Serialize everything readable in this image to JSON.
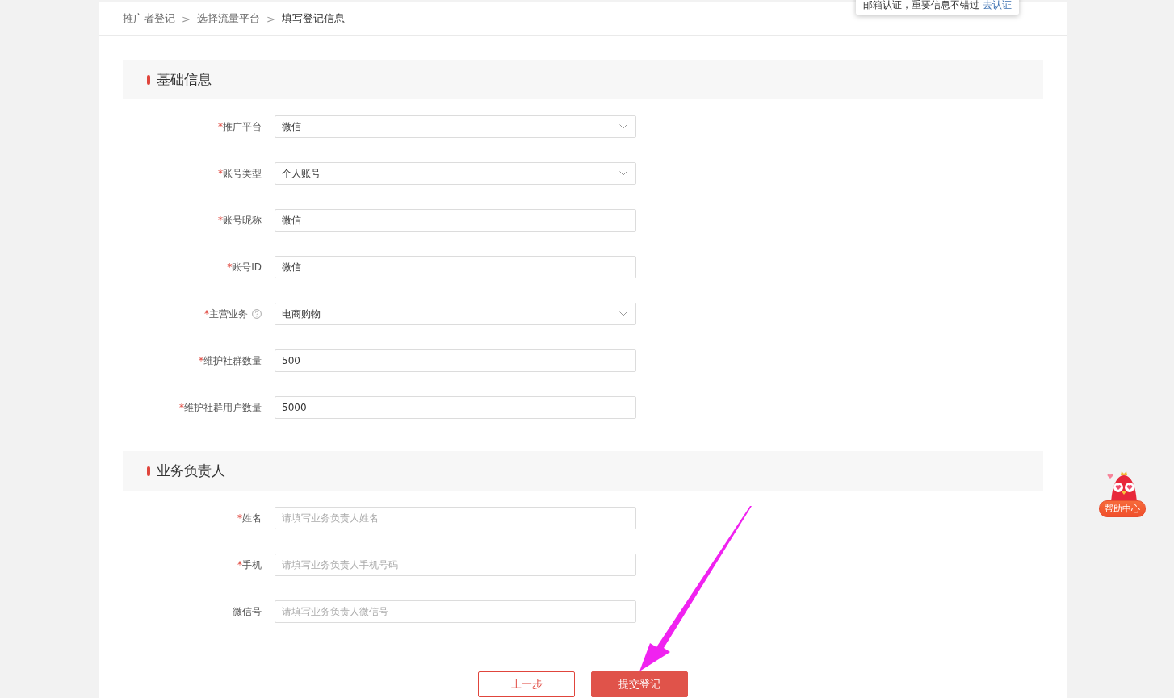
{
  "breadcrumb": [
    {
      "label": "推广者登记",
      "current": false
    },
    {
      "label": "选择流量平台",
      "current": false
    },
    {
      "label": "填写登记信息",
      "current": true
    }
  ],
  "breadcrumb_separator": ">",
  "notice": {
    "text": "邮箱认证，重要信息不错过",
    "link": "去认证"
  },
  "sections": [
    {
      "title": "基础信息",
      "fields": [
        {
          "label": "推广平台",
          "mark": "*",
          "kind": "select",
          "value": "微信"
        },
        {
          "label": "账号类型",
          "mark": "*",
          "kind": "select",
          "value": "个人账号"
        },
        {
          "label": "账号昵称",
          "mark": "*",
          "kind": "input",
          "value": "微信"
        },
        {
          "label": "账号ID",
          "mark": "*",
          "kind": "input",
          "value": "微信"
        },
        {
          "label": "主营业务",
          "mark": "*",
          "kind": "select",
          "value": "电商购物",
          "help": true
        },
        {
          "label": "维护社群数量",
          "mark": "*",
          "kind": "input",
          "value": "500"
        },
        {
          "label": "维护社群用户数量",
          "mark": "*",
          "kind": "input",
          "value": "5000"
        }
      ]
    },
    {
      "title": "业务负责人",
      "fields": [
        {
          "label": "姓名",
          "mark": "*",
          "kind": "input",
          "placeholder": "请填写业务负责人姓名"
        },
        {
          "label": "手机",
          "mark": "*",
          "kind": "input",
          "placeholder": "请填写业务负责人手机号码"
        },
        {
          "label": "微信号",
          "kind": "input",
          "placeholder": "请填写业务负责人微信号"
        }
      ]
    }
  ],
  "buttons": [
    {
      "label": "上一步",
      "kind": "secondary"
    },
    {
      "label": "提交登记",
      "kind": "primary"
    }
  ],
  "help_widget": {
    "label": "帮助中心"
  }
}
